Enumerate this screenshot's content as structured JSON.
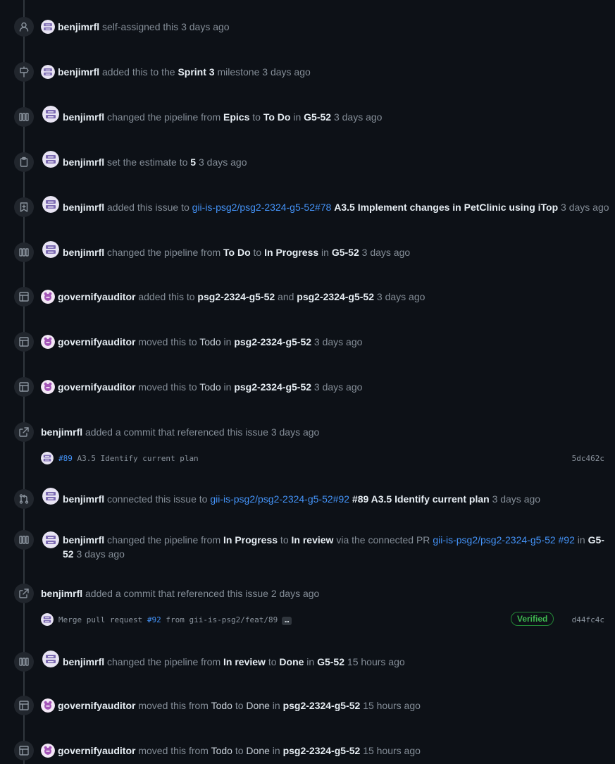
{
  "events": {
    "e1": {
      "actor": "benjimrfl",
      "t1": " self-assigned this ",
      "time": "3 days ago"
    },
    "e2": {
      "actor": "benjimrfl",
      "t1": " added this to the ",
      "milestone": "Sprint 3",
      "t2": " milestone ",
      "time": "3 days ago"
    },
    "e3": {
      "actor": "benjimrfl",
      "t1": " changed the pipeline from ",
      "from": "Epics",
      "t2": " to ",
      "to": "To Do",
      "t3": " in ",
      "where": "G5-52",
      "time": "3 days ago"
    },
    "e4": {
      "actor": "benjimrfl",
      "t1": " set the estimate to ",
      "estimate": "5",
      "time": "3 days ago"
    },
    "e5": {
      "actor": "benjimrfl",
      "t1": " added this issue to ",
      "link": "gii-is-psg2/psg2-2324-g5-52#78",
      "title": "A3.5 Implement changes in PetClinic using iTop",
      "time": "3 days ago"
    },
    "e6": {
      "actor": "benjimrfl",
      "t1": " changed the pipeline from ",
      "from": "To Do",
      "t2": " to ",
      "to": "In Progress",
      "t3": " in ",
      "where": "G5-52",
      "time": "3 days ago"
    },
    "e7": {
      "actor": "governifyauditor",
      "t1": " added this to ",
      "p1": "psg2-2324-g5-52",
      "t2": " and ",
      "p2": "psg2-2324-g5-52",
      "time": "3 days ago"
    },
    "e8": {
      "actor": "governifyauditor",
      "t1": " moved this to ",
      "status": "Todo",
      "t2": " in ",
      "project": "psg2-2324-g5-52",
      "time": "3 days ago"
    },
    "e9": {
      "actor": "governifyauditor",
      "t1": " moved this to ",
      "status": "Todo",
      "t2": " in ",
      "project": "psg2-2324-g5-52",
      "time": "3 days ago"
    },
    "e10": {
      "actor": "benjimrfl",
      "t1": " added a commit that referenced this issue ",
      "time": "3 days ago",
      "commit": {
        "ref": "#89",
        "msg": " A3.5 Identify current plan",
        "sha": "5dc462c"
      }
    },
    "e11": {
      "actor": "benjimrfl",
      "t1": " connected this issue to ",
      "link": "gii-is-psg2/psg2-2324-g5-52#92",
      "title": "#89 A3.5 Identify current plan",
      "time": "3 days ago"
    },
    "e12": {
      "actor": "benjimrfl",
      "t1": " changed the pipeline from ",
      "from": "In Progress",
      "t2": " to ",
      "to": "In review",
      "t3": " via the connected PR ",
      "link": "gii-is-psg2/psg2-2324-g5-52 #92",
      "t4": " in ",
      "where": "G5-52",
      "time": "3 days ago"
    },
    "e13": {
      "actor": "benjimrfl",
      "t1": " added a commit that referenced this issue ",
      "time": "2 days ago",
      "commit": {
        "msg1": "Merge pull request ",
        "ref": "#92",
        "msg2": " from gii-is-psg2/feat/89",
        "ellipsis": "…",
        "verified": "Verified",
        "sha": "d44fc4c"
      }
    },
    "e14": {
      "actor": "benjimrfl",
      "t1": " changed the pipeline from ",
      "from": "In review",
      "t2": " to ",
      "to": "Done",
      "t3": " in ",
      "where": "G5-52",
      "time": "15 hours ago"
    },
    "e15": {
      "actor": "governifyauditor",
      "t1": " moved this from ",
      "from": "Todo",
      "t2": " to ",
      "to": "Done",
      "t3": " in ",
      "project": "psg2-2324-g5-52",
      "time": "15 hours ago"
    },
    "e16": {
      "actor": "governifyauditor",
      "t1": " moved this from ",
      "from": "Todo",
      "t2": " to ",
      "to": "Done",
      "t3": " in ",
      "project": "psg2-2324-g5-52",
      "time": "15 hours ago"
    }
  },
  "colors": {
    "accent": "#4493f8",
    "verified": "#3fb950",
    "background": "#0d1117"
  }
}
